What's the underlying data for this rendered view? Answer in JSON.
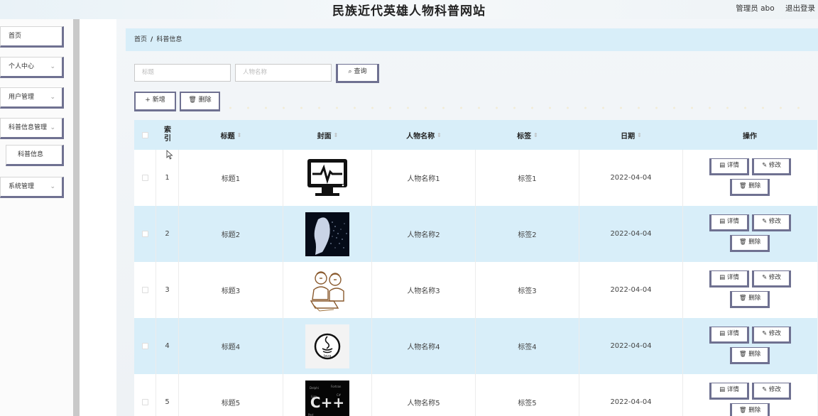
{
  "header": {
    "title": "民族近代英雄人物科普网站",
    "user": "管理员 abo",
    "logout": "退出登录"
  },
  "sidebar": {
    "items": [
      {
        "label": "首页"
      },
      {
        "label": "个人中心",
        "chevron": "⌄"
      },
      {
        "label": "用户管理",
        "chevron": "⌄"
      },
      {
        "label": "科普信息管理",
        "chevron": "⌄"
      },
      {
        "label": "科普信息"
      },
      {
        "label": "系统管理",
        "chevron": "⌄"
      }
    ]
  },
  "breadcrumb": {
    "home": "首页",
    "sep": "/",
    "current": "科普信息"
  },
  "search": {
    "title_placeholder": "标题",
    "name_placeholder": "人物名称",
    "query_label": "查询",
    "query_icon": "⌕"
  },
  "actions": {
    "add_label": "+ 新增",
    "delete_label": "删除"
  },
  "table": {
    "columns": [
      {
        "label": "索引"
      },
      {
        "label": "标题",
        "sort": "⇕"
      },
      {
        "label": "封面",
        "sort": "⇕"
      },
      {
        "label": "人物名称",
        "sort": "⇕"
      },
      {
        "label": "标签",
        "sort": "⇕"
      },
      {
        "label": "日期",
        "sort": "⇕"
      },
      {
        "label": "操作"
      }
    ],
    "rows": [
      {
        "index": "1",
        "title": "标题1",
        "cover": "monitor-heartbeat",
        "name": "人物名称1",
        "tag": "标签1",
        "date": "2022-04-04"
      },
      {
        "index": "2",
        "title": "标题2",
        "cover": "particle-head",
        "name": "人物名称2",
        "tag": "标签2",
        "date": "2022-04-04"
      },
      {
        "index": "3",
        "title": "标题3",
        "cover": "sketch-people-laptop",
        "name": "人物名称3",
        "tag": "标签3",
        "date": "2022-04-04"
      },
      {
        "index": "4",
        "title": "标题4",
        "cover": "java-logo",
        "name": "人物名称4",
        "tag": "标签4",
        "date": "2022-04-04"
      },
      {
        "index": "5",
        "title": "标题5",
        "cover": "code-word-cloud",
        "name": "人物名称5",
        "tag": "标签5",
        "date": "2022-04-04"
      }
    ],
    "ops": {
      "detail": "详情",
      "edit": "修改",
      "delete": "删除"
    }
  }
}
